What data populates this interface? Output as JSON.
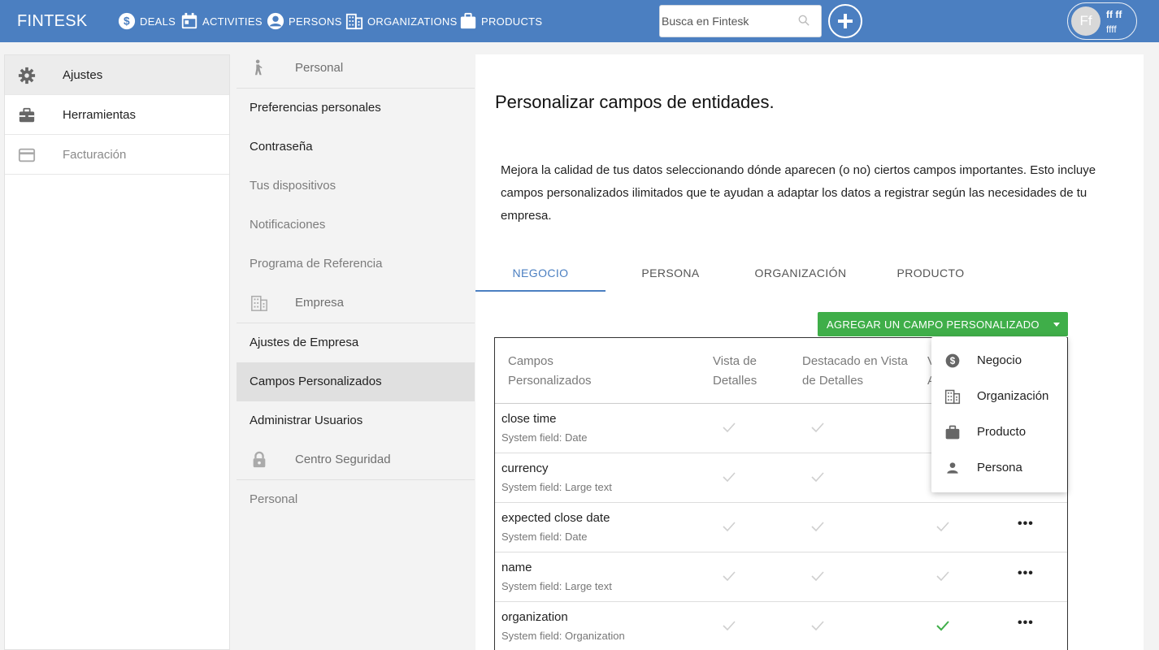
{
  "topbar": {
    "brand": "FINTESK",
    "nav": [
      {
        "label": "DEALS",
        "icon": "dollar-circle-icon"
      },
      {
        "label": "ACTIVITIES",
        "icon": "calendar-icon"
      },
      {
        "label": "PERSONS",
        "icon": "person-circle-icon"
      },
      {
        "label": "ORGANIZATIONS",
        "icon": "building-icon"
      },
      {
        "label": "PRODUCTS",
        "icon": "briefcase-icon"
      }
    ],
    "search_placeholder": "Busca en Fintesk",
    "user": {
      "initials": "Ff",
      "name": "ff ff",
      "sub": "ffff"
    }
  },
  "sidebar": {
    "items": [
      {
        "label": "Ajustes",
        "icon": "gear-icon",
        "active": true
      },
      {
        "label": "Herramientas",
        "icon": "toolbox-icon",
        "active": false
      },
      {
        "label": "Facturación",
        "icon": "credit-card-icon",
        "active": false
      }
    ]
  },
  "submenu": {
    "personal_header": "Personal",
    "items_personal": [
      "Preferencias personales",
      "Contraseña",
      "Tus dispositivos",
      "Notificaciones",
      "Programa de Referencia"
    ],
    "company_header": "Empresa",
    "items_company": [
      "Ajustes de Empresa",
      "Campos Personalizados",
      "Administrar Usuarios"
    ],
    "security_header": "Centro Seguridad",
    "items_security": [
      "Personal"
    ]
  },
  "main": {
    "title": "Personalizar campos de entidades.",
    "description": "Mejora la calidad de tus datos seleccionando dónde aparecen (o no) ciertos campos importantes. Esto incluye campos personalizados ilimitados que te ayudan a adaptar los datos a registrar según las necesidades de tu empresa.",
    "tabs": [
      "NEGOCIO",
      "PERSONA",
      "ORGANIZACIÓN",
      "PRODUCTO"
    ],
    "active_tab": "NEGOCIO",
    "add_button": "AGREGAR UN CAMPO PERSONALIZADO",
    "table": {
      "headers": [
        "Campos Personalizados",
        "Vista de Detalles",
        "Destacado en Vista de Detalles",
        "V A"
      ],
      "rows": [
        {
          "name": "close time",
          "type": "System field: Date",
          "checks": [
            false,
            false,
            false
          ],
          "more": false
        },
        {
          "name": "currency",
          "type": "System field: Large text",
          "checks": [
            false,
            false,
            false
          ],
          "more": false
        },
        {
          "name": "expected close date",
          "type": "System field: Date",
          "checks": [
            false,
            false,
            false
          ],
          "more": true
        },
        {
          "name": "name",
          "type": "System field: Large text",
          "checks": [
            false,
            false,
            false
          ],
          "more": true
        },
        {
          "name": "organization",
          "type": "System field: Organization",
          "checks": [
            false,
            false,
            true
          ],
          "more": true
        }
      ],
      "more_label": "•••"
    }
  },
  "dropdown": {
    "items": [
      {
        "label": "Negocio",
        "icon": "dollar-circle-icon"
      },
      {
        "label": "Organización",
        "icon": "building-icon"
      },
      {
        "label": "Producto",
        "icon": "briefcase-icon"
      },
      {
        "label": "Persona",
        "icon": "person-icon"
      }
    ]
  },
  "colors": {
    "topbar": "#4b7fc1",
    "accent": "#4b7fc1",
    "add_button": "#3fae49",
    "check_on": "#3fae49",
    "check_off": "#cfcfcf"
  }
}
